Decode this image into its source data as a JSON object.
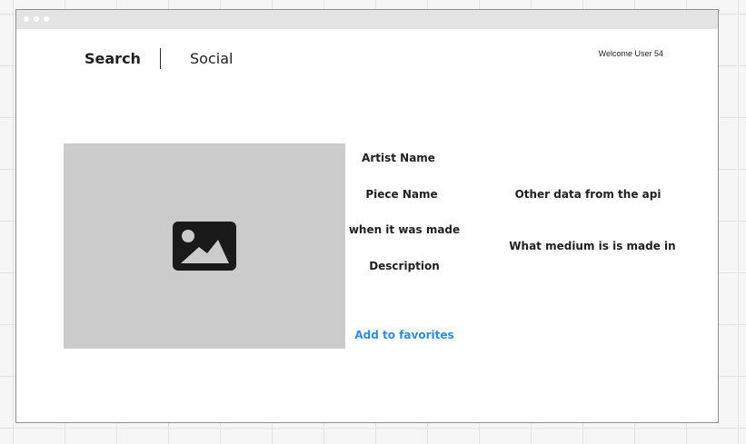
{
  "window": {
    "titlebar_icons": [
      "window-dot-icon",
      "window-dot-icon",
      "window-dot-icon"
    ]
  },
  "nav": {
    "search_label": "Search",
    "social_label": "Social"
  },
  "header": {
    "welcome_text": "Welcome User 54"
  },
  "artwork": {
    "image_icon": "image-placeholder-icon",
    "artist_name": "Artist Name",
    "piece_name": "Piece Name",
    "when_made": "when it was made",
    "description": "Description",
    "other_data": "Other data from the api",
    "medium": "What medium is is made in",
    "favorite_label": "Add to favorites"
  },
  "colors": {
    "link": "#2d8bea",
    "image_placeholder": "#cbcbcb",
    "titlebar": "#e4e4e4"
  }
}
